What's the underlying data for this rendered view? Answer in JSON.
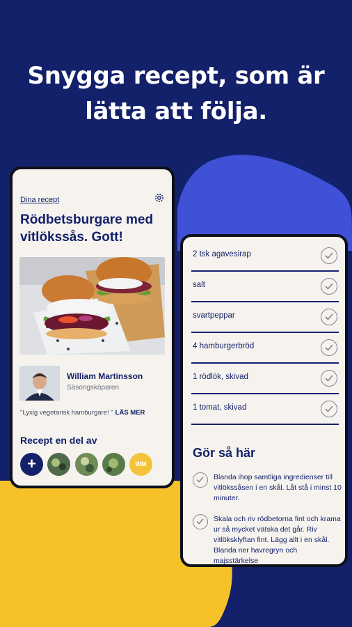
{
  "colors": {
    "background": "#13216b",
    "accent_blue": "#3f51d6",
    "accent_yellow": "#f7c12a",
    "card": "#f6f3ee",
    "ink": "#13216b"
  },
  "headline": {
    "line1": "Snygga recept, som är",
    "line2": "lätta att följa."
  },
  "left_phone": {
    "back_link": "Dina recept",
    "settings_icon": "gear-icon",
    "title": "Rödbetsburgare med vitlökssås. Gott!",
    "author_name": "William Martinsson",
    "author_role": "Säsongsköparen",
    "quote": "\"Lyxig vegetarisk hamburgare! \"",
    "read_more": "LÄS MER",
    "section_title": "Recept en del av",
    "add_label": "+",
    "initials": "WM"
  },
  "right_phone": {
    "ingredients": [
      {
        "text": "2 tsk agavesirap"
      },
      {
        "text": "salt"
      },
      {
        "text": "svartpeppar"
      },
      {
        "text": "4  hamburgerbröd"
      },
      {
        "text": "1  rödlök, skivad"
      },
      {
        "text": "1  tomat, skivad"
      }
    ],
    "section_title": "Gör så här",
    "steps": [
      {
        "text": "Blanda ihop samtliga ingredienser till vitlökssåsen i en skål. Låt stå i minst 10 minuter."
      },
      {
        "text": "Skala och riv rödbetorna fint och krama ur så mycket vätska det går. Riv vitlöksklyftan fint. Lägg allt i en skål. Blanda ner havregryn och majsstärkelse"
      }
    ]
  }
}
